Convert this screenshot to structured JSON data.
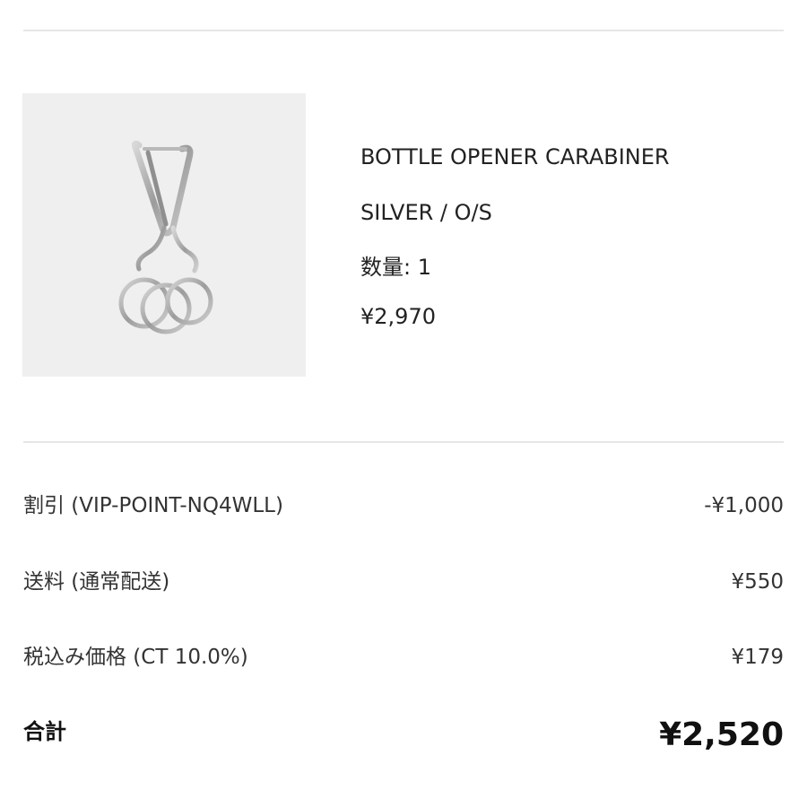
{
  "product": {
    "name": "BOTTLE OPENER CARABINER",
    "variant": "SILVER / O/S",
    "quantity": "数量: 1",
    "price": "¥2,970",
    "image_bg": "#efefef"
  },
  "summary": {
    "discount": {
      "label": "割引 (VIP-POINT-NQ4WLL)",
      "value": "-¥1,000"
    },
    "shipping": {
      "label": "送料 (通常配送)",
      "value": "¥550"
    },
    "tax": {
      "label": "税込み価格 (CT 10.0%)",
      "value": "¥179"
    },
    "total": {
      "label": "合計",
      "value": "¥2,520"
    }
  },
  "colors": {
    "divider": "#e6e6e6",
    "text": "#222222",
    "metal": "#a8a8a8"
  }
}
